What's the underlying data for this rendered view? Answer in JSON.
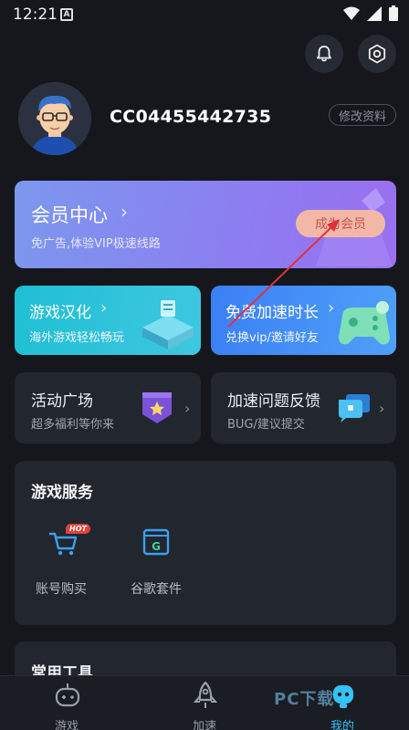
{
  "status_bar": {
    "time": "12:21",
    "notification_glyph": "A"
  },
  "header": {
    "bell_icon": "bell-icon",
    "settings_icon": "settings-icon"
  },
  "profile": {
    "username": "CC04455442735",
    "edit_label": "修改资料"
  },
  "vip": {
    "title": "会员中心",
    "subtitle": "免广告,体验VIP极速线路",
    "button_label": "成为会员"
  },
  "feature_cards": [
    {
      "title": "游戏汉化",
      "subtitle": "海外游戏轻松畅玩"
    },
    {
      "title": "免费加速时长",
      "subtitle": "兑换vip/邀请好友"
    }
  ],
  "info_cards": [
    {
      "title": "活动广场",
      "subtitle": "超多福利等你来"
    },
    {
      "title": "加速问题反馈",
      "subtitle": "BUG/建议提交"
    }
  ],
  "services": {
    "title": "游戏服务",
    "items": [
      {
        "label": "账号购买",
        "badge": "HOT",
        "icon": "cart-icon"
      },
      {
        "label": "谷歌套件",
        "icon": "google-suite-icon"
      }
    ]
  },
  "tools": {
    "title": "常用工具"
  },
  "bottom_nav": [
    {
      "label": "游戏",
      "icon": "gamepad-icon",
      "active": false
    },
    {
      "label": "加速",
      "icon": "rocket-icon",
      "active": false
    },
    {
      "label": "我的",
      "icon": "profile-robot-icon",
      "active": true
    }
  ],
  "watermark": "PC下载",
  "colors": {
    "background": "#15171d",
    "card": "#22262e",
    "accent": "#34c3f5",
    "vip_button": "#f3b7a8"
  }
}
